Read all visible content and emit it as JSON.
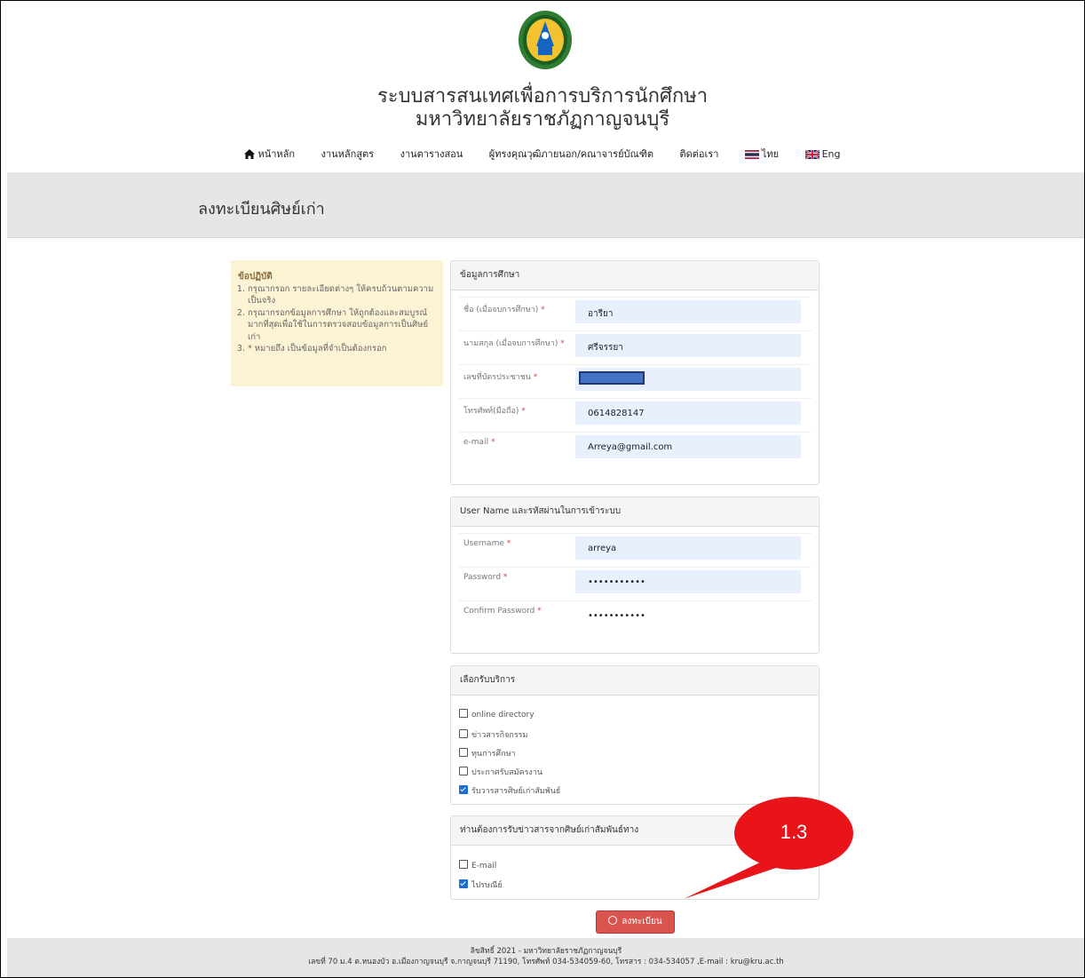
{
  "header": {
    "title_line1": "ระบบสารสนเทศเพื่อการบริการนักศึกษา",
    "title_line2": "มหาวิทยาลัยราชภัฏกาญจนบุรี"
  },
  "nav": {
    "home": "หน้าหลัก",
    "curriculum": "งานหลักสูตร",
    "schedule": "งานตารางสอน",
    "experts": "ผู้ทรงคุณวุฒิภายนอก/คณาจารย์บัณฑิต",
    "contact": "ติดต่อเรา",
    "thai": "ไทย",
    "eng": "Eng"
  },
  "page_title": "ลงทะเบียนศิษย์เก่า",
  "rules": {
    "title": "ข้อปฏิบัติ",
    "items": [
      "กรุณากรอก รายละเอียดต่างๆ ให้ครบถ้วนตามความเป็นจริง",
      "กรุณากรอกข้อมูลการศึกษา ให้ถูกต้องและสมบูรณ์มากที่สุดเพื่อใช้ในการตรวจสอบข้อมูลการเป็นศิษย์เก่า",
      "* หมายถึง เป็นข้อมูลที่จำเป็นต้องกรอก"
    ]
  },
  "education": {
    "heading": "ข้อมูลการศึกษา",
    "first_name_label": "ชื่อ (เมื่อจบการศึกษา)",
    "first_name_value": "อารียา",
    "last_name_label": "นามสกุล (เมื่อจบการศึกษา)",
    "last_name_value": "ศรีจรรยา",
    "id_label": "เลขที่บัตรประชาชน",
    "phone_label": "โทรศัพท์(มือถือ)",
    "phone_value": "0614828147",
    "email_label": "e-mail",
    "email_value": "Arreya@gmail.com",
    "required_mark": "*"
  },
  "account": {
    "heading": "User Name และรหัสผ่านในการเข้าระบบ",
    "username_label": "Username",
    "username_value": "arreya",
    "password_label": "Password",
    "password_value": "•••••••••••",
    "confirm_label": "Confirm Password",
    "confirm_value": "•••••••••••"
  },
  "services": {
    "heading": "เลือกรับบริการ",
    "options": [
      {
        "label": "online directory",
        "checked": false
      },
      {
        "label": "ข่าวสารกิจกรรม",
        "checked": false
      },
      {
        "label": "ทุนการศึกษา",
        "checked": false
      },
      {
        "label": "ประกาศรับสมัครงาน",
        "checked": false
      },
      {
        "label": "รับวารสารศิษย์เก่าสัมพันธ์",
        "checked": true
      }
    ]
  },
  "channel": {
    "heading": "ท่านต้องการรับข่าวสารจากศิษย์เก่าสัมพันธ์ทาง",
    "options": [
      {
        "label": "E-mail",
        "checked": false
      },
      {
        "label": "ไปรษณีย์",
        "checked": true
      }
    ]
  },
  "submit_label": "ลงทะเบียน",
  "callout_label": "1.3",
  "footer": {
    "line1": "ลิขสิทธิ์ 2021 - มหาวิทยาลัยราชภัฏกาญจนบุรี",
    "line2": "เลขที่ 70 ม.4 ต.หนองบัว อ.เมืองกาญจนบุรี จ.กาญจนบุรี 71190, โทรศัพท์ 034-534059-60, โทรสาร : 034-534057 ,E-mail : kru@kru.ac.th"
  },
  "colors": {
    "accent_button": "#d9534f",
    "callout": "#e8141a",
    "input_bg": "#e8f0fe",
    "notice_bg": "#fcf3d4"
  }
}
